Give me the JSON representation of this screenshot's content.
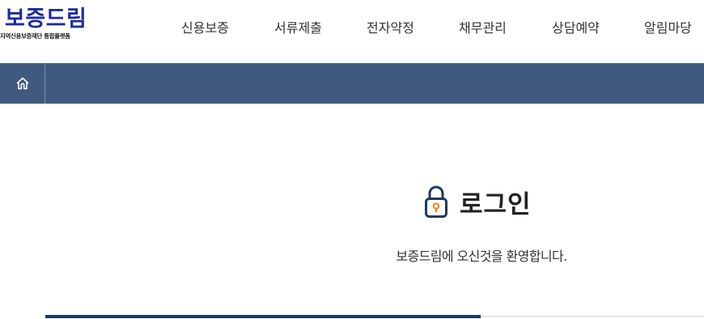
{
  "header": {
    "logo_title": "보증드림",
    "logo_subtitle": "지역신용보증재단 통합플랫폼",
    "brand_color": "#1d2c9c",
    "nav": [
      {
        "label": "신용보증"
      },
      {
        "label": "서류제출"
      },
      {
        "label": "전자약정"
      },
      {
        "label": "채무관리"
      },
      {
        "label": "상담예약"
      },
      {
        "label": "알림마당"
      }
    ]
  },
  "subnav": {
    "background_color": "#3f5a7e",
    "home_icon": "home-icon"
  },
  "login": {
    "icon": "lock-icon",
    "title": "로그인",
    "welcome_message": "보증드림에 오신것을 환영합니다.",
    "accent_color": "#1e3a62"
  }
}
